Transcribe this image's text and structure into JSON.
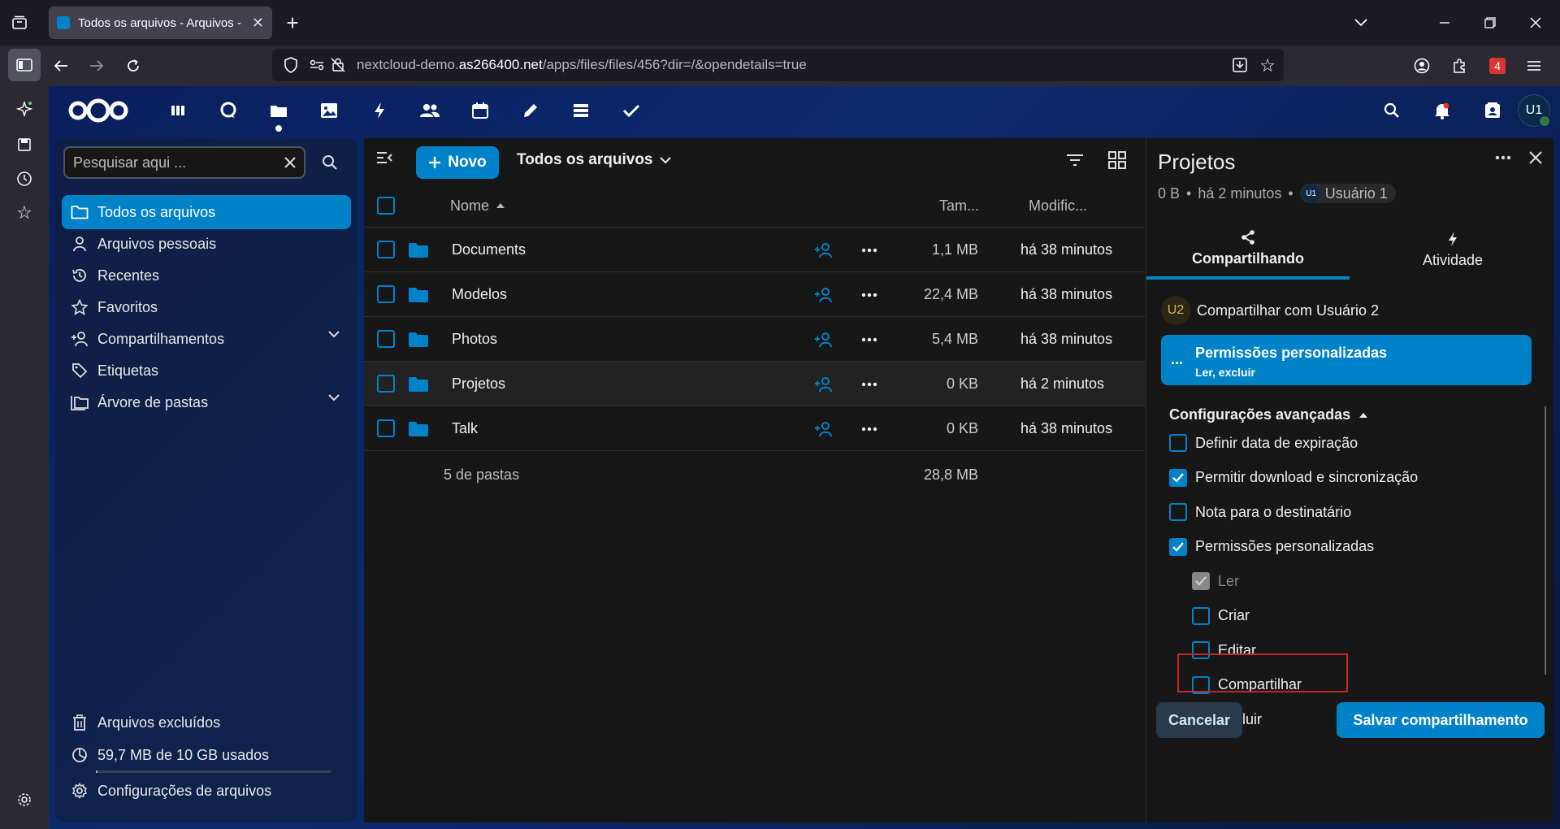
{
  "browser": {
    "tab_title": "Todos os arquivos - Arquivos - N",
    "url_prefix": "nextcloud-demo.",
    "url_host": "as266400.net",
    "url_path": "/apps/files/files/456?dir=/&opendetails=true",
    "extensions_badge": "4"
  },
  "header": {
    "avatar_initials": "U1",
    "apps": [
      "dashboard-icon",
      "talk-icon",
      "files-icon",
      "photos-icon",
      "activity-icon",
      "contacts-icon",
      "calendar-icon",
      "notes-icon",
      "deck-icon",
      "tasks-icon"
    ]
  },
  "nav": {
    "search_placeholder": "Pesquisar aqui ...",
    "items": [
      {
        "label": "Todos os arquivos",
        "icon": "folder-icon"
      },
      {
        "label": "Arquivos pessoais",
        "icon": "person-icon"
      },
      {
        "label": "Recentes",
        "icon": "history-icon"
      },
      {
        "label": "Favoritos",
        "icon": "star-icon"
      },
      {
        "label": "Compartilhamentos",
        "icon": "share-icon"
      },
      {
        "label": "Etiquetas",
        "icon": "tag-icon"
      },
      {
        "label": "Árvore de pastas",
        "icon": "folder-tree-icon"
      }
    ],
    "deleted": "Arquivos excluídos",
    "quota": "59,7 MB de 10 GB usados",
    "quota_fraction": 0.006,
    "settings": "Configurações de arquivos"
  },
  "files": {
    "new_label": "Novo",
    "breadcrumb": "Todos os arquivos",
    "columns": {
      "name": "Nome",
      "size": "Tam...",
      "modified": "Modific..."
    },
    "rows": [
      {
        "name": "Documents",
        "size": "1,1 MB",
        "modified": "há 38 minutos"
      },
      {
        "name": "Modelos",
        "size": "22,4 MB",
        "modified": "há 38 minutos"
      },
      {
        "name": "Photos",
        "size": "5,4 MB",
        "modified": "há 38 minutos"
      },
      {
        "name": "Projetos",
        "size": "0 KB",
        "modified": "há 2 minutos"
      },
      {
        "name": "Talk",
        "size": "0 KB",
        "modified": "há 38 minutos"
      }
    ],
    "footer_count": "5 de pastas",
    "footer_size": "28,8 MB"
  },
  "details": {
    "title": "Projetos",
    "size": "0 B",
    "time": "há 2 minutos",
    "owner_initials": "U1",
    "owner": "Usuário 1",
    "tabs": [
      "Compartilhando",
      "Atividade"
    ],
    "share_initials": "U2",
    "share_with": "Compartilhar com Usuário 2",
    "perm_title": "Permissões personalizadas",
    "perm_sub": "Ler, excluir",
    "perm_dots": "...",
    "advanced": "Configurações avançadas",
    "options": [
      {
        "label": "Definir data de expiração",
        "checked": false
      },
      {
        "label": "Permitir download e sincronização",
        "checked": true
      },
      {
        "label": "Nota para o destinatário",
        "checked": false
      },
      {
        "label": "Permissões personalizadas",
        "checked": true
      }
    ],
    "perms": [
      {
        "label": "Ler",
        "checked": true,
        "disabled": true
      },
      {
        "label": "Criar",
        "checked": false
      },
      {
        "label": "Editar",
        "checked": false
      },
      {
        "label": "Compartilhar",
        "checked": false
      },
      {
        "label": "Excluir",
        "checked": true
      }
    ],
    "cancel": "Cancelar",
    "save": "Salvar compartilhamento"
  }
}
